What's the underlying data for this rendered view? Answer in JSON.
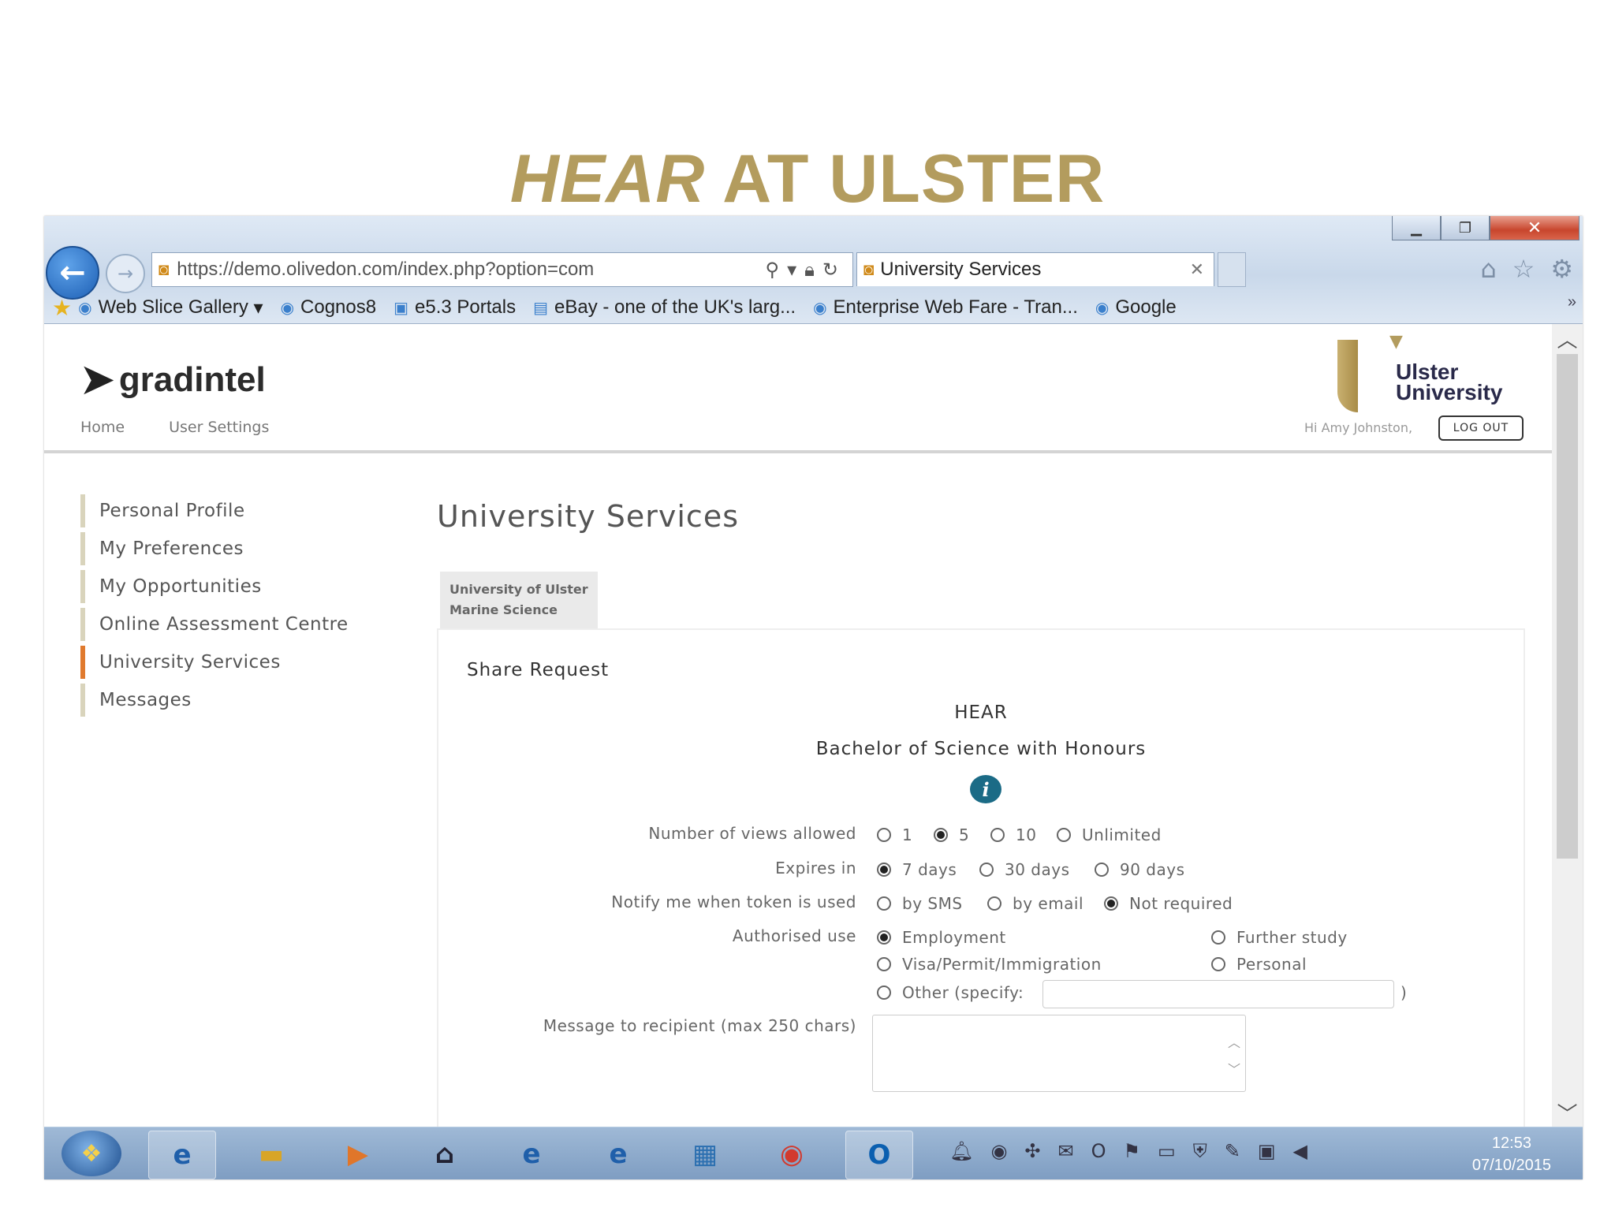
{
  "slide": {
    "title_italic": "HEAR",
    "title_rest": "AT ULSTER"
  },
  "browser": {
    "url": "https://demo.olivedon.com/index.php?option=com",
    "tab_title": "University Services",
    "favorites": [
      "Web Slice Gallery",
      "Cognos8",
      "e5.3 Portals",
      "eBay - one of the UK's larg...",
      "Enterprise Web Fare - Tran...",
      "Google"
    ]
  },
  "app": {
    "logo_text": "gradintel",
    "nav": [
      "Home",
      "User Settings"
    ],
    "university_logo": [
      "Ulster",
      "University"
    ],
    "greeting": "Hi Amy Johnston,",
    "logout": "LOG OUT"
  },
  "sidebar": {
    "items": [
      "Personal Profile",
      "My Preferences",
      "My Opportunities",
      "Online Assessment Centre",
      "University Services",
      "Messages"
    ],
    "active_index": 4
  },
  "main": {
    "title": "University Services",
    "institution_tab": [
      "University of Ulster",
      "Marine Science"
    ],
    "panel_title": "Share Request",
    "document": "HEAR",
    "degree": "Bachelor of Science with Honours",
    "form": {
      "views_label": "Number of views allowed",
      "views_options": [
        "1",
        "5",
        "10",
        "Unlimited"
      ],
      "views_selected": "5",
      "expires_label": "Expires in",
      "expires_options": [
        "7 days",
        "30 days",
        "90 days"
      ],
      "expires_selected": "7 days",
      "notify_label": "Notify me when token is used",
      "notify_options": [
        "by SMS",
        "by email",
        "Not required"
      ],
      "notify_selected": "Not required",
      "use_label": "Authorised use",
      "use_options": [
        "Employment",
        "Further study",
        "Visa/Permit/Immigration",
        "Personal",
        "Other (specify:"
      ],
      "use_selected": "Employment",
      "other_close": ")",
      "message_label": "Message to recipient (max 250 chars)"
    }
  },
  "taskbar": {
    "time": "12:53",
    "date": "07/10/2015"
  },
  "colors": {
    "title_gold": "#b39c5e",
    "active_marker": "#e07a2e",
    "info_icon": "#1b6b86"
  }
}
